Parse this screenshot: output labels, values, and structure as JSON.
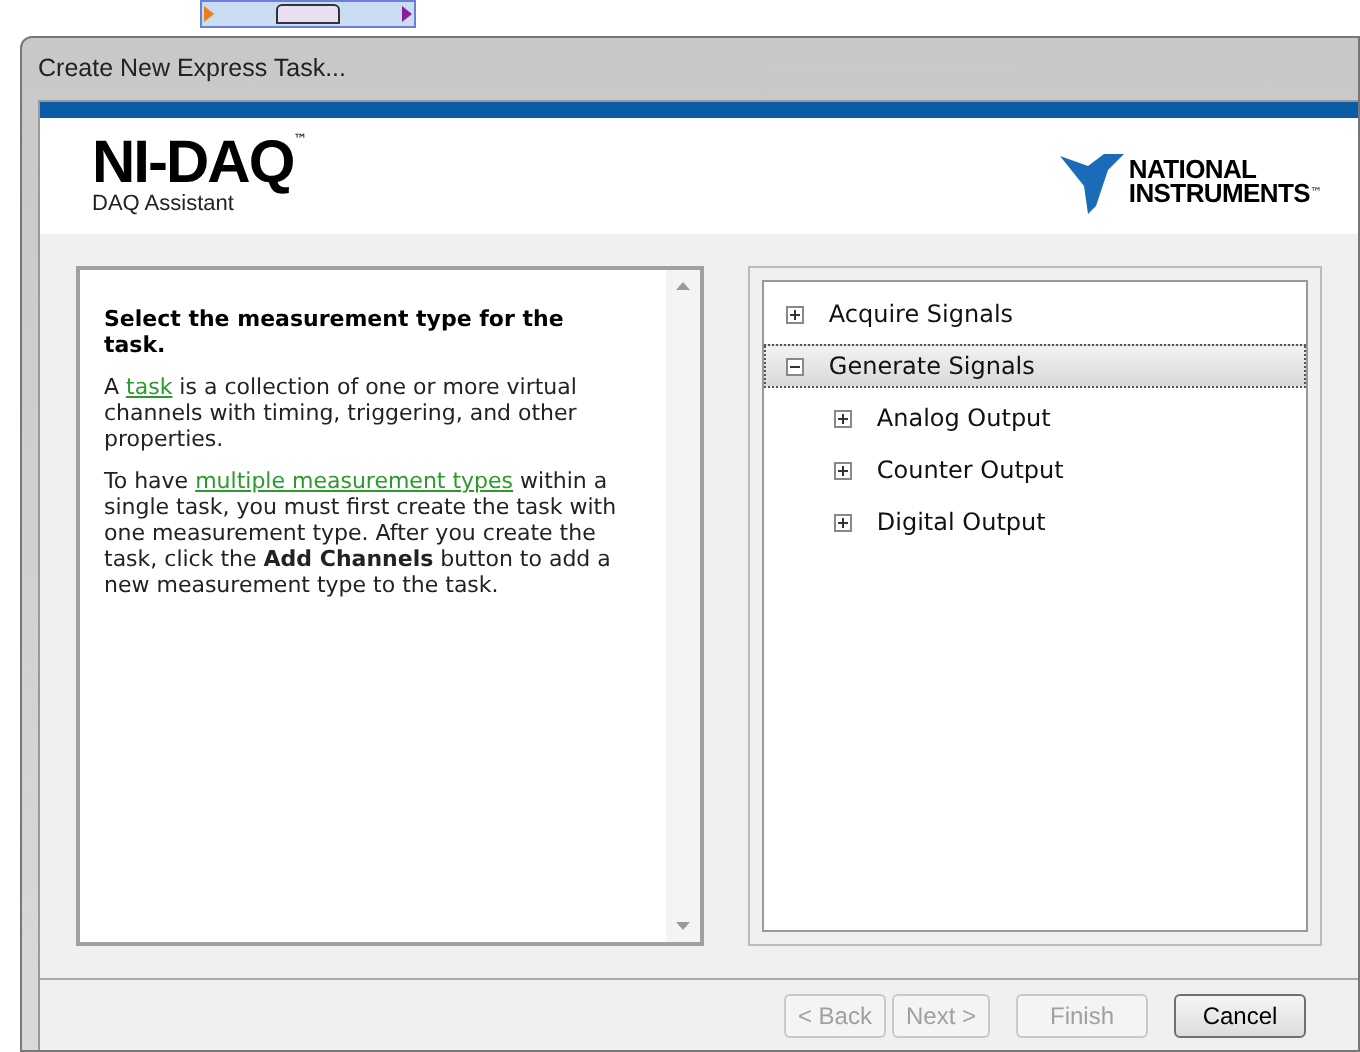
{
  "window": {
    "title": "Create New Express Task..."
  },
  "header": {
    "product": "NI-DAQ",
    "trademark": "™",
    "subtitle": "DAQ Assistant",
    "brand_lines": [
      "NATIONAL",
      "INSTRUMENTS"
    ],
    "brand_trademark": "™"
  },
  "help": {
    "heading": "Select the measurement type for the task.",
    "paragraphs": [
      [
        {
          "kind": "text",
          "text": "A "
        },
        {
          "kind": "link",
          "text": "task"
        },
        {
          "kind": "text",
          "text": " is a collection of one or more virtual channels with timing, triggering, and other properties."
        }
      ],
      [
        {
          "kind": "text",
          "text": "To have "
        },
        {
          "kind": "link",
          "text": "multiple measurement types"
        },
        {
          "kind": "text",
          "text": " within a single task, you must first create the task with one measurement type. After you create the task, click the **Add Channels** button to add a new measurement type to the task."
        }
      ]
    ]
  },
  "tree": [
    {
      "label": "Acquire Signals",
      "expanded": false,
      "selected": false
    },
    {
      "label": "Generate Signals",
      "expanded": true,
      "selected": true,
      "children": [
        {
          "label": "Analog Output",
          "expanded": false,
          "selected": false
        },
        {
          "label": "Counter Output",
          "expanded": false,
          "selected": false
        },
        {
          "label": "Digital Output",
          "expanded": false,
          "selected": false
        }
      ]
    }
  ],
  "buttons": [
    {
      "label": "< Back",
      "disabled": true
    },
    {
      "label": "Next >",
      "disabled": true
    },
    {
      "label": "Finish",
      "disabled": true
    },
    {
      "label": "Cancel",
      "disabled": false
    }
  ]
}
